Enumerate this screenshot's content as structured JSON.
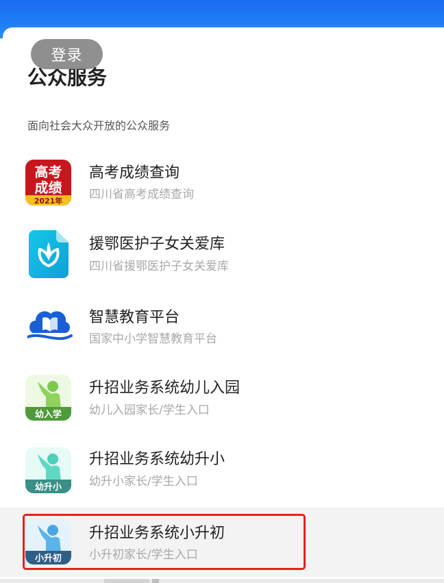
{
  "header": {
    "login_label": "登录",
    "title": "公众服务",
    "subtitle": "面向社会大众开放的公众服务"
  },
  "services": [
    {
      "title": "高考成绩查询",
      "desc": "四川省高考成绩查询",
      "icon": "gaokao-score-icon",
      "icon_text_top": "高考",
      "icon_text_bottom": "成绩",
      "icon_badge": "2021年"
    },
    {
      "title": "援鄂医护子女关爱库",
      "desc": "四川省援鄂医护子女关爱库",
      "icon": "leaf-icon"
    },
    {
      "title": "智慧教育平台",
      "desc": "国家中小学智慧教育平台",
      "icon": "cloud-book-icon"
    },
    {
      "title": "升招业务系统幼儿入园",
      "desc": "幼儿入园家长/学生入口",
      "icon": "kindergarten-icon",
      "icon_badge": "幼入学"
    },
    {
      "title": "升招业务系统幼升小",
      "desc": "幼升小家长/学生入口",
      "icon": "primary-entry-icon",
      "icon_badge": "幼升小"
    },
    {
      "title": "升招业务系统小升初",
      "desc": "小升初家长/学生入口",
      "icon": "junior-entry-icon",
      "icon_badge": "小升初",
      "highlighted": true
    }
  ],
  "colors": {
    "header_blue": "#1b6cf0",
    "highlight_border": "#e8201a",
    "gaokao_red": "#c8161d",
    "leaf_cyan": "#12b6e0",
    "cloud_blue": "#1a5fd6",
    "green_badge": "#4f9a3a",
    "teal_badge": "#3a8f86",
    "navy_badge": "#2f5f86"
  }
}
